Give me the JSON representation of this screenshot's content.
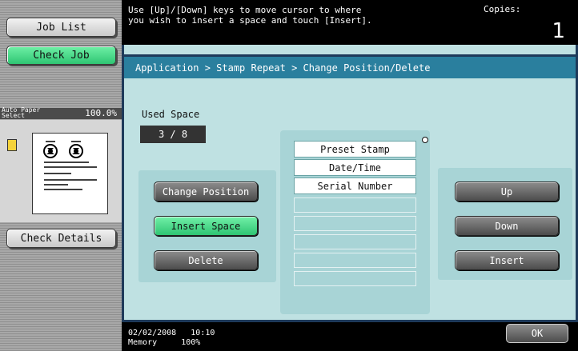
{
  "left": {
    "job_list": "Job List",
    "check_job": "Check Job",
    "paper_line1": "Auto Paper",
    "paper_line2": "Select",
    "zoom": "100.0%",
    "check_details": "Check Details"
  },
  "header": {
    "message_line1": "Use [Up]/[Down] keys to move cursor to where",
    "message_line2": "you wish to insert a space and touch [Insert].",
    "copies_label": "Copies:",
    "copies_value": "1"
  },
  "breadcrumb": "Application > Stamp Repeat > Change Position/Delete",
  "used_space": {
    "label": "Used Space",
    "value": "3 / 8"
  },
  "left_actions": {
    "change_position": "Change Position",
    "insert_space": "Insert Space",
    "delete": "Delete"
  },
  "stamp_list": {
    "items": [
      "Preset Stamp",
      "Date/Time",
      "Serial Number"
    ],
    "empty_slots": 5
  },
  "right_actions": {
    "up": "Up",
    "down": "Down",
    "insert": "Insert"
  },
  "status": {
    "date": "02/02/2008",
    "time": "10:10",
    "memory_label": "Memory",
    "memory_value": "100%",
    "ok": "OK"
  },
  "colors": {
    "panel_bg": "#bfe1e2",
    "breadcrumb_bg": "#2a7f9e",
    "active_green": "#2fc573"
  }
}
